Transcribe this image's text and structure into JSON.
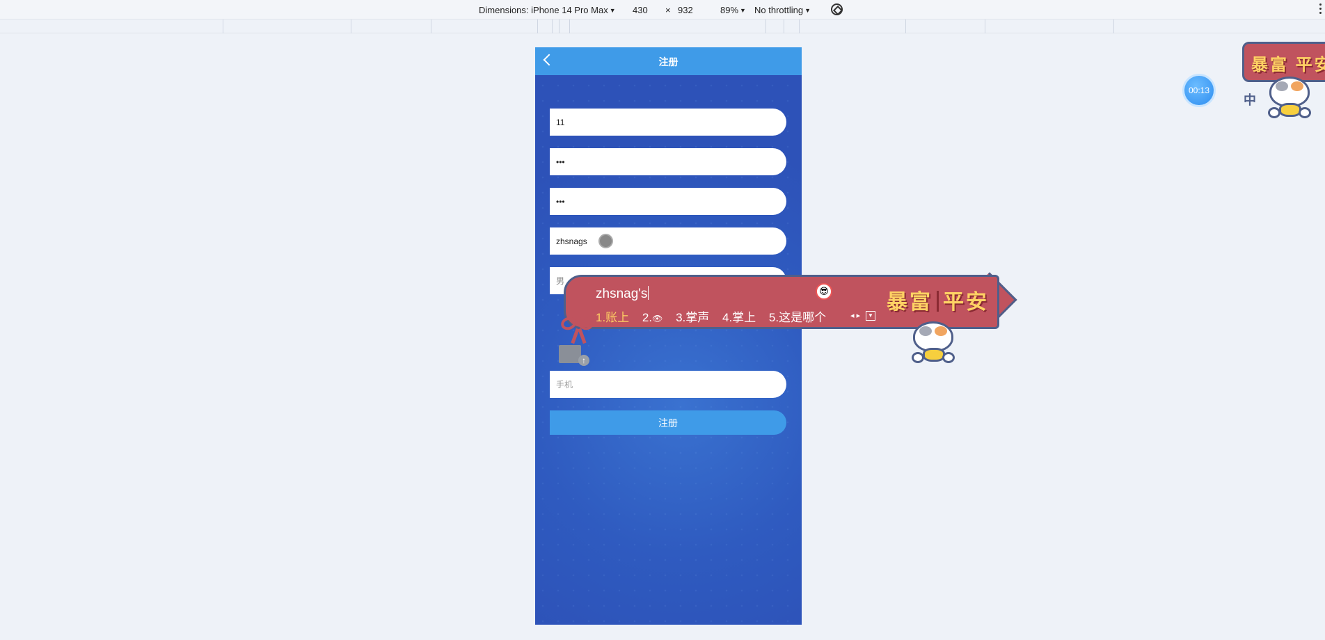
{
  "devtools": {
    "dimensions_label": "Dimensions: iPhone 14 Pro Max",
    "width": "430",
    "times": "×",
    "height": "932",
    "zoom": "89%",
    "throttling": "No throttling"
  },
  "page": {
    "title": "注册",
    "fields": {
      "username": "11",
      "password": "•••",
      "confirm_password": "•••",
      "nickname": "zhsnags",
      "gender_placeholder": "男",
      "phone_placeholder": "手机"
    },
    "submit_label": "注册"
  },
  "timer": "00:13",
  "ime": {
    "composition": "zhsnag's",
    "candidates": [
      "1.账上",
      "2.",
      "3.掌声",
      "4.掌上",
      "5.这是哪个"
    ],
    "brand_left": "暴富",
    "brand_right": "平安"
  },
  "sticker": {
    "text": "暴富 平安",
    "icon": "中"
  }
}
